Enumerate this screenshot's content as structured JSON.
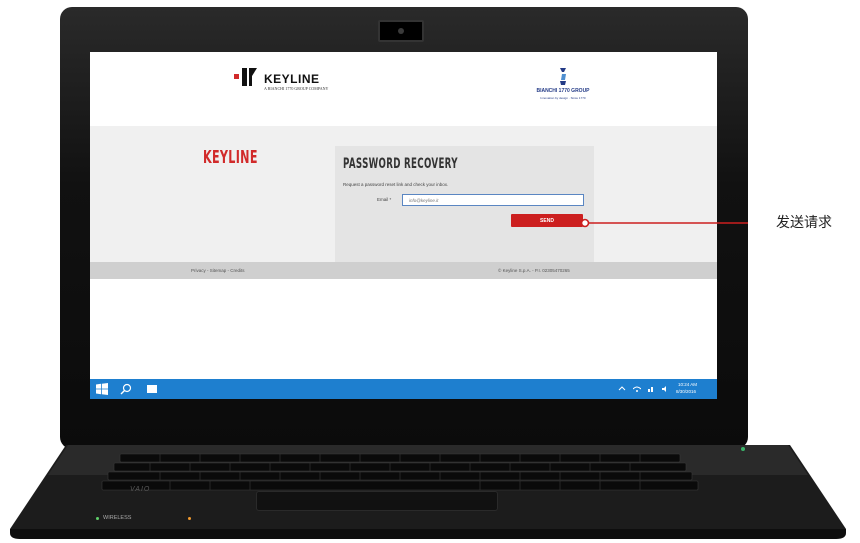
{
  "header": {
    "keyline_wordmark": "KEYLINE",
    "keyline_tagline": "A BIANCHI 1770 GROUP COMPANY",
    "bianchi_name": "BIANCHI 1770 GROUP",
    "bianchi_tagline": "Innovation by design · Since 1770"
  },
  "brand_title": "KEYLINE",
  "recovery": {
    "title": "PASSWORD RECOVERY",
    "description": "Request a password reset link and check your inbox.",
    "email_label": "Email *",
    "email_placeholder": "info@keyline.it",
    "send_label": "SEND"
  },
  "footer": {
    "links": "Privacy - Sitemap - Credits",
    "copyright": "© Keyline S.p.A. - P.I. 02305470265"
  },
  "taskbar": {
    "time": "10:24 AM",
    "date": "8/30/2016"
  },
  "laptop": {
    "status_wireless": "WIRELESS",
    "brand": "VAIO"
  },
  "callout": {
    "label": "发送请求",
    "color": "#cc1f1f"
  },
  "colors": {
    "brand_red": "#cc1f1f",
    "taskbar_blue": "#1e7fcf",
    "bianchi_blue": "#233a86"
  }
}
